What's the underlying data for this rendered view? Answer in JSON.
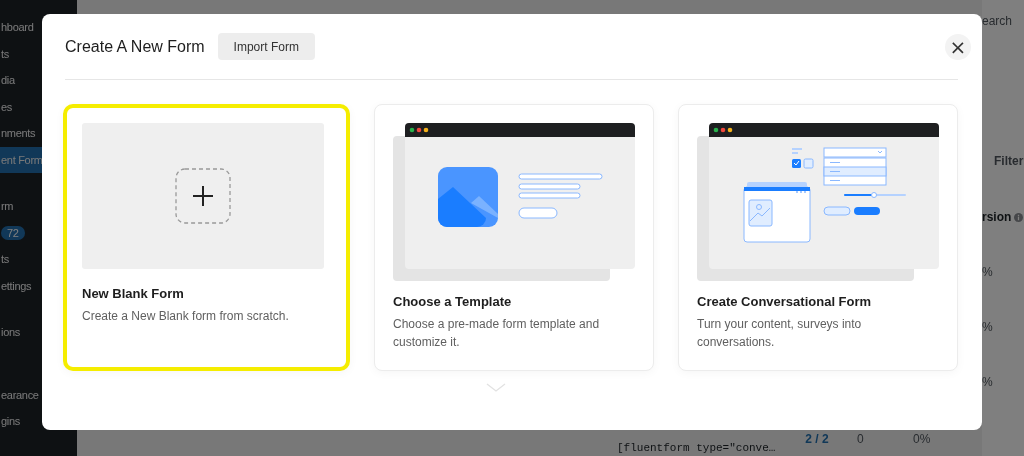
{
  "background": {
    "sidebar": [
      {
        "label": "hboard",
        "selected": false
      },
      {
        "label": "ts",
        "selected": false
      },
      {
        "label": "dia",
        "selected": false
      },
      {
        "label": "es",
        "selected": false
      },
      {
        "label": "nments",
        "selected": false
      },
      {
        "label": "ent Form",
        "selected": true
      },
      {
        "label": "rm",
        "selected": false
      },
      {
        "label": "72",
        "selected": false,
        "kind": "badge"
      },
      {
        "label": "ts",
        "selected": false
      },
      {
        "label": "ettings",
        "selected": false
      },
      {
        "label": "ions",
        "selected": false
      },
      {
        "label": "earance",
        "selected": false
      },
      {
        "label": "gins",
        "selected": false
      }
    ],
    "search_label": "earch",
    "filter_label": "Filter",
    "column_header": "rsion",
    "column_values": [
      "%",
      "%",
      "%"
    ],
    "last_row": {
      "entries": "2 / 2",
      "views": "0",
      "conversion": "0%",
      "shortcode": "[fluentform type=\"conve…"
    }
  },
  "modal": {
    "title": "Create A New Form",
    "import_button": "Import Form",
    "close": "×",
    "cards": [
      {
        "kind": "blank",
        "title": "New Blank Form",
        "description": "Create a New Blank form from scratch.",
        "selected": true
      },
      {
        "kind": "template",
        "title": "Choose a Template",
        "description": "Choose a pre-made form template and customize it.",
        "selected": false
      },
      {
        "kind": "conversational",
        "title": "Create Conversational Form",
        "description": "Turn your content, surveys into conversations.",
        "selected": false
      }
    ]
  }
}
